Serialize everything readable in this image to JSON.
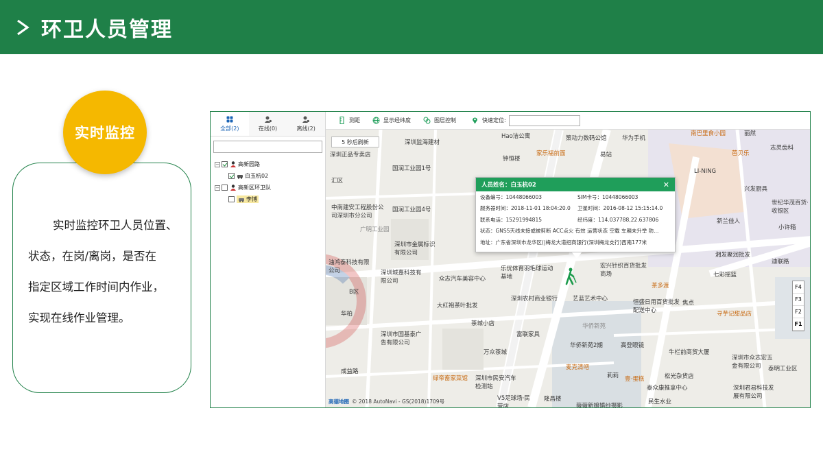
{
  "header": {
    "title": "环卫人员管理"
  },
  "badge": {
    "label": "实时监控"
  },
  "description": {
    "line1": "实时监控环卫人员位置、",
    "line2": "状态，在岗/离岗，是否在",
    "line3": "指定区域工作时间内作业，",
    "line4": "实现在线作业管理。"
  },
  "side": {
    "tabs": [
      {
        "label": "全部(2)",
        "icon": "group-icon"
      },
      {
        "label": "在线(0)",
        "icon": "person-online-icon"
      },
      {
        "label": "离线(2)",
        "icon": "person-offline-icon"
      }
    ],
    "search": {
      "value": ""
    },
    "tree": [
      {
        "label": "高新园路",
        "checked": true
      },
      {
        "label": "白玉杭02",
        "checked": true
      },
      {
        "label": "高新区环卫队",
        "checked": false
      },
      {
        "label": "李博",
        "checked": false
      }
    ]
  },
  "toolbar": {
    "measure": "测距",
    "latlng": "显示经纬度",
    "layers": "图层控制",
    "quick_locate": "快速定位:",
    "quick_locate_value": ""
  },
  "map": {
    "refresh": "5 秒后刷新",
    "pois": [
      "Hao洁公寓",
      "策动力数码公馆",
      "华为手机",
      "南巴里食小园",
      "丽然",
      "深圳正品专卖店",
      "深圳监海建材",
      "钟恒楼",
      "家乐福前面",
      "易站",
      "芭贝乐",
      "志灵齿科",
      "国润工业园1号",
      "LI-NING",
      "兴发厨具",
      "汇区",
      "世纪华茂百货·收银区",
      "中南建安工程股份公司深圳市分公司",
      "国润工业园4号",
      "新兰佳人",
      "小许箱",
      "广明工业园",
      "深圳市金属标识有限公司",
      "湘发聚润批发",
      "迪联路",
      "油鸿泰科技有限公司",
      "宏兴针织百货批发商场",
      "七彩摇篮",
      "深圳城嘉科技有限公司",
      "乐优体育羽毛球运动基地",
      "众志汽车美容中心",
      "茶多渡",
      "B区",
      "深圳农村商业银行",
      "艺蓝艺术中心",
      "恒盛日用百货批发配送中心",
      "焦点",
      "大红袍茶叶批发",
      "寻芋记甜品店",
      "华柏",
      "华侨新苑",
      "茶城小店",
      "富联家具",
      "深圳市国基泰广告有限公司",
      "华侨新苑2期",
      "高登眼镜",
      "万众茶城",
      "牛栏前商贸大厦",
      "绿帝畜家菜馆",
      "深圳市民安汽车检测站",
      "麦克清吧",
      "莉莉",
      "壹·蛋糕",
      "松光杂货店",
      "泰众康推拿中心",
      "深圳市众志宏五金有限公司",
      "泰明工业区",
      "成益路",
      "隆昌楼",
      "V5足球场·民营店",
      "薇薇新娘婚纱摄影",
      "民生水业",
      "深圳君易科技发展有限公司"
    ],
    "floors": [
      "F4",
      "F3",
      "F2",
      "F1"
    ],
    "copyright": "© 2018 AutoNavi - GS(2018)1709号",
    "copyright_logo": "高德地图"
  },
  "popup": {
    "title": "人员姓名：白玉杭02",
    "rows": [
      [
        "设备编号：10448066003",
        "SIM卡号：10448066003"
      ],
      [
        "服务器时间：2018-11-01 18:04:20.0",
        "卫星时间：2016-08-12 15:15:14.0"
      ],
      [
        "联系电话：15291994815",
        "经纬度：114.037788,22.637806"
      ],
      [
        "状态：GNSS天线未接或被剪断 ACC点火 有效 运营状态 空载 车厢未升举 防..."
      ],
      [
        "地址：广东省深圳市龙华区(|梅龙大道招商银行(深圳梅龙支行)西南177米"
      ]
    ]
  },
  "colors": {
    "header": "#1f8048",
    "badge": "#f5b800",
    "popup_header": "#1f9e5a"
  }
}
